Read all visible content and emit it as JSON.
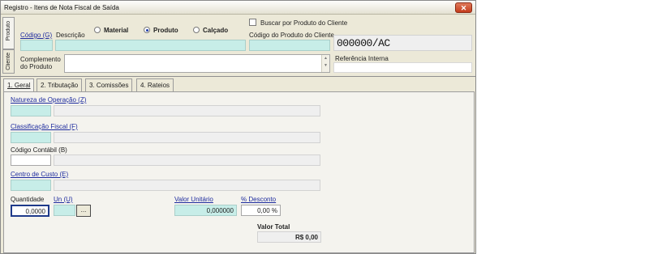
{
  "window": {
    "title": "Registro - Itens de Nota Fiscal de Saída",
    "close": "✕"
  },
  "vertical_tabs": [
    "Produto",
    "Cliente"
  ],
  "product_section": {
    "codigo_label": "Código (G)",
    "descricao_label": "Descrição",
    "radio_options": [
      {
        "label": "Material",
        "selected": false
      },
      {
        "label": "Produto",
        "selected": true
      },
      {
        "label": "Calçado",
        "selected": false
      }
    ],
    "buscar_label": "Buscar por Produto do Cliente",
    "codigo_cliente_label": "Código do Produto do Cliente",
    "codigo_display": "000000/AC",
    "complemento_label": "Complemento do Produto",
    "referencia_label": "Referência Interna"
  },
  "tabs": [
    {
      "label": "1. Geral",
      "active": true
    },
    {
      "label": "2. Tributação",
      "active": false
    },
    {
      "label": "3. Comissões",
      "active": false
    },
    {
      "label": "4. Rateios",
      "active": false
    }
  ],
  "general": {
    "natureza_label": "Natureza de Operação (Z)",
    "classificacao_label": "Classificação Fiscal (F)",
    "codigo_contabil_label": "Código Contábil (B)",
    "centro_custo_label": "Centro de Custo (E)",
    "quantidade_label": "Quantidade",
    "quantidade_value": "0,0000",
    "unid_label": "Un (U)",
    "browse_button": "...",
    "valor_unitario_label": "Valor Unitário",
    "valor_unitario_value": "0,000000",
    "desconto_label": "% Desconto",
    "desconto_value": "0,00 %",
    "valor_total_label": "Valor Total",
    "valor_total_value": "R$ 0,00"
  },
  "colors": {
    "window_bg": "#ece9d8",
    "field_teal": "#c7ede8",
    "link_blue": "#1d2b9e",
    "close_red": "#c43c1c"
  }
}
